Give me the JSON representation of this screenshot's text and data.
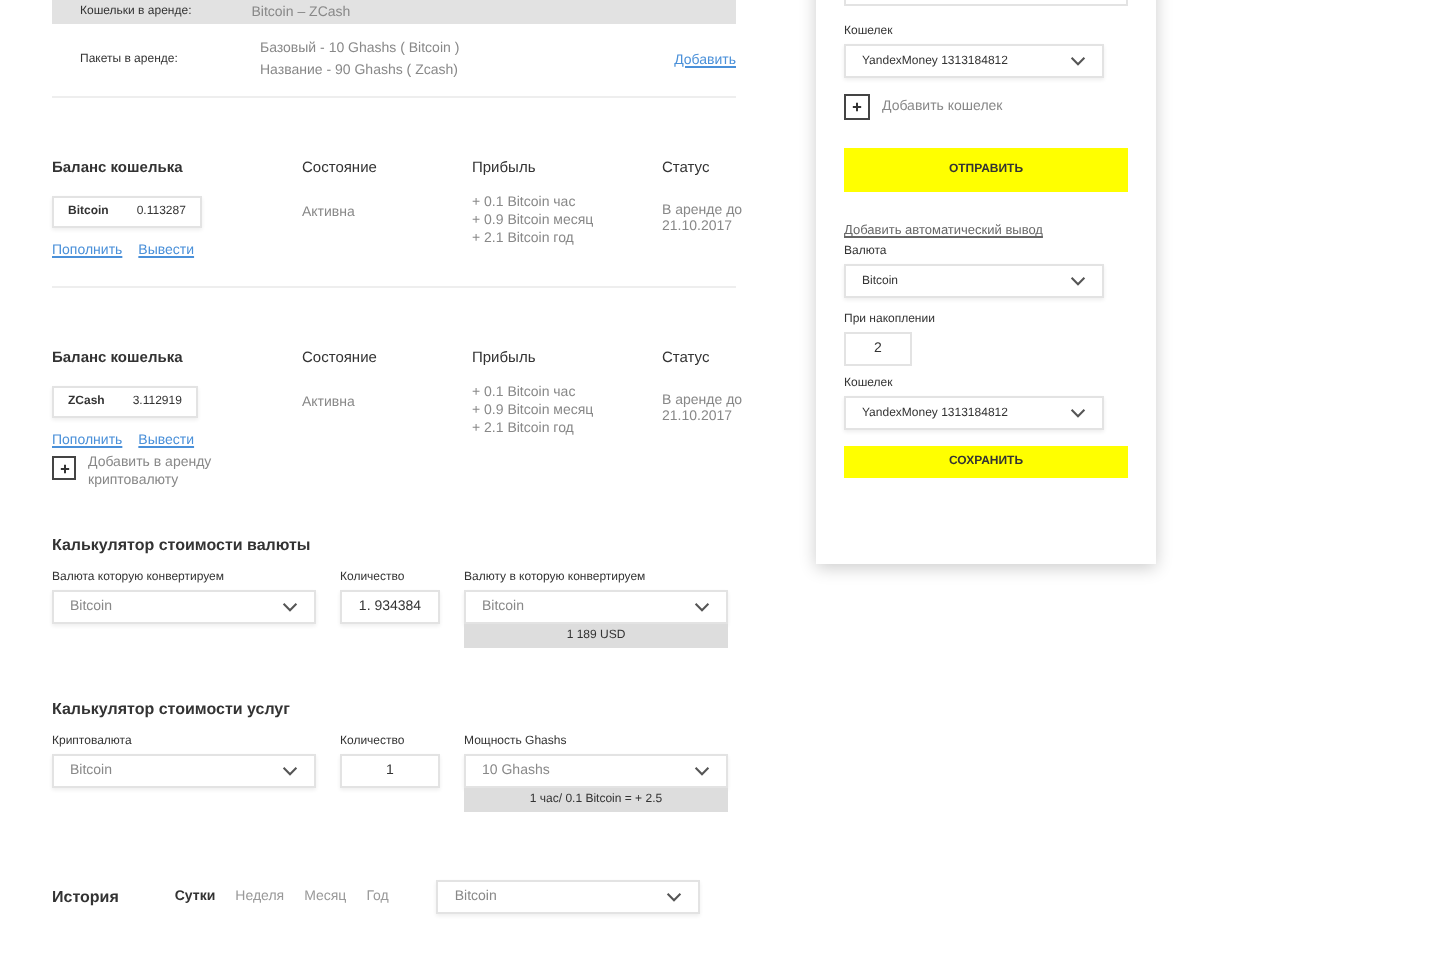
{
  "rented": {
    "wallets_label": "Кошельки в аренде:",
    "wallets_value": "Bitcoin – ZCash",
    "packages_label": "Пакеты в аренде:",
    "packages": [
      "Базовый - 10 Ghashs ( Bitcoin )",
      "Название - 90 Ghashs ( Zcash)"
    ],
    "add_link": "Добавить"
  },
  "wallets": [
    {
      "headers": [
        "Баланс кошелька",
        "Состояние",
        "Прибыль",
        "Статус"
      ],
      "currency": "Bitcoin",
      "balance": "0.113287",
      "state": "Активна",
      "profit": [
        "+ 0.1 Bitcoin час",
        "+ 0.9 Bitcoin месяц",
        "+ 2.1 Bitcoin год"
      ],
      "status": "В аренде до 21.10.2017",
      "links": [
        "Пополнить",
        "Вывести"
      ]
    },
    {
      "headers": [
        "Баланс кошелька",
        "Состояние",
        "Прибыль",
        "Статус"
      ],
      "currency": "ZCash",
      "balance": "3.112919",
      "state": "Активна",
      "profit": [
        "+ 0.1 Bitcoin час",
        "+ 0.9 Bitcoin месяц",
        "+ 2.1 Bitcoin год"
      ],
      "status": "В аренде до 21.10.2017",
      "links": [
        "Пополнить",
        "Вывести"
      ]
    }
  ],
  "add_crypto": "Добавить в аренду криптовалюту",
  "calculators": [
    {
      "title": "Калькулятор стоимости валюты",
      "from_label": "Валюта которую конвертируем",
      "from_value": "Bitcoin",
      "qty_label": "Количество",
      "qty_value": "1. 934384",
      "to_label": "Валюту в которую конвертируем",
      "to_value": "Bitcoin",
      "result": "1 189 USD"
    },
    {
      "title": "Калькулятор стоимости услуг",
      "from_label": "Криптовалюта",
      "from_value": "Bitcoin",
      "qty_label": "Количество",
      "qty_value": "1",
      "to_label": "Мощность  Ghashs",
      "to_value": "10 Ghashs",
      "result": "1 час/ 0.1 Bitcoin = + 2.5"
    }
  ],
  "history": {
    "title": "История",
    "periods": [
      {
        "label": "Сутки",
        "selected": true
      },
      {
        "label": "Неделя",
        "selected": false
      },
      {
        "label": "Месяц",
        "selected": false
      },
      {
        "label": "Год",
        "selected": false
      }
    ],
    "currency": "Bitcoin"
  },
  "withdraw": {
    "wallet_label": "Кошелек",
    "wallet_value": "YandexMoney  1313184812",
    "add_wallet": "Добавить кошелек",
    "send_button": "ОТПРАВИТЬ",
    "auto_link": "Добавить автоматический вывод",
    "currency_label": "Валюта",
    "currency_value": "Bitcoin",
    "threshold_label": "При накоплении",
    "threshold_value": "2",
    "wallet2_label": "Кошелек",
    "wallet2_value": "YandexMoney  1313184812",
    "save_button": "СОХРАНИТЬ"
  }
}
